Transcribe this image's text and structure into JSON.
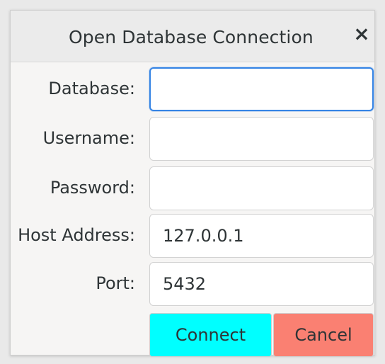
{
  "dialog": {
    "title": "Open Database Connection",
    "close_symbol": "×"
  },
  "fields": {
    "database": {
      "label": "Database:",
      "value": ""
    },
    "username": {
      "label": "Username:",
      "value": ""
    },
    "password": {
      "label": "Password:",
      "value": ""
    },
    "host": {
      "label": "Host Address:",
      "value": "127.0.0.1"
    },
    "port": {
      "label": "Port:",
      "value": "5432"
    }
  },
  "buttons": {
    "connect": {
      "label": "Connect",
      "color": "#00ffff"
    },
    "cancel": {
      "label": "Cancel",
      "color": "#fa8072"
    }
  },
  "colors": {
    "focus_border": "#3584e4"
  }
}
